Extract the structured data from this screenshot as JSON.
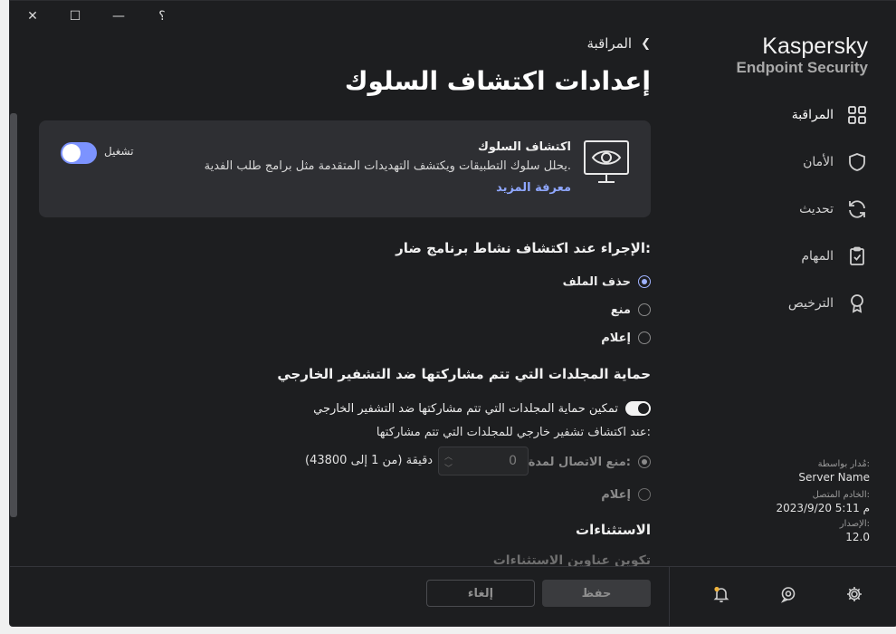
{
  "window": {
    "controls": {
      "close": "✕",
      "maximize": "☐",
      "minimize": "—",
      "help": "؟"
    }
  },
  "sidebar": {
    "brand_name": "Kaspersky",
    "brand_product": "Endpoint Security",
    "items": [
      {
        "label": "المراقبة",
        "icon": "dashboard-grid-icon",
        "active": true
      },
      {
        "label": "الأمان",
        "icon": "shield-icon",
        "active": false
      },
      {
        "label": "تحديث",
        "icon": "refresh-icon",
        "active": false
      },
      {
        "label": "المهام",
        "icon": "clipboard-check-icon",
        "active": false
      },
      {
        "label": "الترخيص",
        "icon": "award-ribbon-icon",
        "active": false
      }
    ],
    "meta": {
      "managed_by_label": "مُدار بواسطة:",
      "managed_by_value": "Server Name",
      "connected_label": "الخادم المتصل:",
      "connected_value": "2023/9/20 5:11 م",
      "version_label": "الإصدار:",
      "version_value": "12.0"
    }
  },
  "main": {
    "breadcrumb": "المراقبة",
    "title": "إعدادات اكتشاف السلوك",
    "card": {
      "title": "اكتشاف السلوك",
      "description": "يحلل سلوك التطبيقات ويكتشف التهديدات المتقدمة مثل برامج طلب الفدية.",
      "link": "معرفة المزيد",
      "toggle_label": "تشغيل",
      "toggle_on": true
    },
    "action_section": {
      "heading": "الإجراء عند اكتشاف نشاط برنامج ضار:",
      "options": [
        {
          "label": "حذف الملف",
          "selected": true
        },
        {
          "label": "منع",
          "selected": false
        },
        {
          "label": "إعلام",
          "selected": false
        }
      ]
    },
    "shared_folders": {
      "heading": "حماية المجلدات التي تتم مشاركتها ضد التشفير الخارجي",
      "toggle_label": "تمكين حماية المجلدات التي تتم مشاركتها ضد التشفير الخارجي",
      "toggle_on": true,
      "sub_label": "عند اكتشاف تشفير خارجي للمجلدات التي تتم مشاركتها:",
      "block_label": "منع الاتصال لمدة:",
      "block_value": "0",
      "minutes_label": "دقيقة (من 1 إلى 43800)",
      "notify_label": "إعلام"
    },
    "exclusions": {
      "heading": "الاستثناءات",
      "configure_link": "تكوين عناوين الاستثناءات"
    }
  },
  "footer": {
    "save": "حفظ",
    "cancel": "إلغاء"
  }
}
